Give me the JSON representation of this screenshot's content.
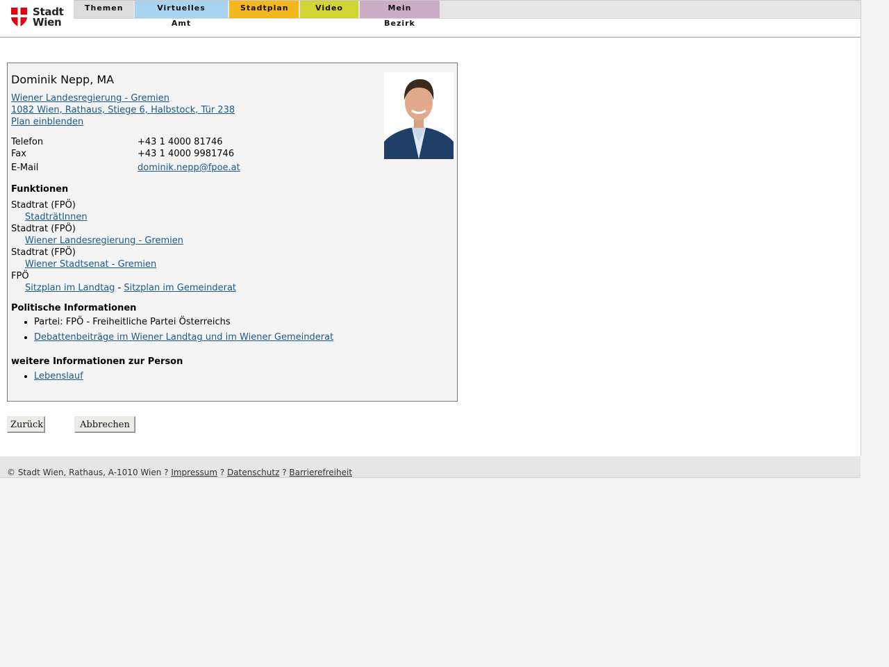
{
  "logo": {
    "line1": "Stadt",
    "line2": "Wien",
    "colors": {
      "shield": "#e3000f"
    }
  },
  "nav": {
    "tabs": [
      {
        "label": "Themen",
        "color": "#dcdcdc"
      },
      {
        "label": "Virtuelles Amt",
        "color": "#a9d4f0"
      },
      {
        "label": "Stadtplan",
        "color": "#f4b81c"
      },
      {
        "label": "Video",
        "color": "#d3d632"
      },
      {
        "label": "Mein Bezirk",
        "color": "#cbaec5"
      }
    ]
  },
  "person": {
    "name": "Dominik Nepp, MA",
    "org_link": "Wiener Landesregierung - Gremien ",
    "address_link": "1082 Wien, Rathaus, Stiege 6, Halbstock, Tür 238",
    "plan_link": "Plan einblenden",
    "contact": {
      "phone_label": "Telefon",
      "phone": "+43 1 4000 81746",
      "fax_label": "Fax",
      "fax": "+43 1 4000 9981746",
      "email_label": "E-Mail",
      "email": "dominik.nepp@fpoe.at"
    }
  },
  "functions": {
    "heading": "Funktionen",
    "items": [
      {
        "role": "Stadtrat (FPÖ)",
        "link": "StadträtInnen"
      },
      {
        "role": "Stadtrat (FPÖ)",
        "link": "Wiener Landesregierung - Gremien"
      },
      {
        "role": "Stadtrat (FPÖ)",
        "link": "Wiener Stadtsenat - Gremien"
      }
    ],
    "party": "FPÖ",
    "seat_link_1": "Sitzplan im Landtag",
    "seat_sep": " - ",
    "seat_link_2": "Sitzplan im Gemeinderat"
  },
  "political": {
    "heading": "Politische Informationen",
    "party_text": "Partei: FPÖ - Freiheitliche Partei Österreichs",
    "debates_link": "Debattenbeiträge im Wiener Landtag und im Wiener Gemeinderat"
  },
  "more": {
    "heading": "weitere Informationen zur Person",
    "cv_link": "Lebenslauf"
  },
  "buttons": {
    "back": "Zurück",
    "cancel": "Abbrechen"
  },
  "footer": {
    "copyright": "© Stadt Wien, Rathaus, A-1010 Wien",
    "sep": " ? ",
    "impressum": "Impressum",
    "datenschutz": "Datenschutz",
    "barrierefreiheit": "Barrierefreiheit"
  }
}
